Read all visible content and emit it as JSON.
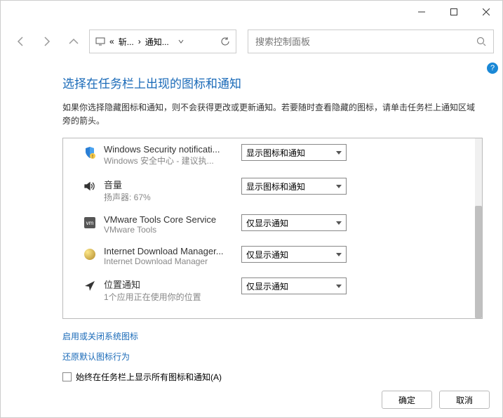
{
  "titlebar": {},
  "nav": {
    "breadcrumb1": "斩...",
    "breadcrumb2": "通知..."
  },
  "search": {
    "placeholder": "搜索控制面板"
  },
  "page": {
    "title": "选择在任务栏上出现的图标和通知",
    "desc": "如果你选择隐藏图标和通知，则不会获得更改或更新通知。若要随时查看隐藏的图标，请单击任务栏上通知区域旁的箭头。"
  },
  "opts": {
    "show_icon_notif": "显示图标和通知",
    "only_notif": "仅显示通知"
  },
  "items": [
    {
      "title": "Windows Security notificati...",
      "sub": "Windows 安全中心 - 建议执...",
      "opt": "显示图标和通知"
    },
    {
      "title": "音量",
      "sub": "扬声器: 67%",
      "opt": "显示图标和通知"
    },
    {
      "title": "VMware Tools Core Service",
      "sub": "VMware Tools",
      "opt": "仅显示通知"
    },
    {
      "title": "Internet Download Manager...",
      "sub": "Internet Download Manager",
      "opt": "仅显示通知"
    },
    {
      "title": "位置通知",
      "sub": "1个应用正在使用你的位置",
      "opt": "仅显示通知"
    }
  ],
  "links": {
    "sys_icons": "启用或关闭系统图标",
    "restore": "还原默认图标行为"
  },
  "checkbox": {
    "label": "始终在任务栏上显示所有图标和通知(A)"
  },
  "footer": {
    "ok": "确定",
    "cancel": "取消"
  },
  "help": "?"
}
